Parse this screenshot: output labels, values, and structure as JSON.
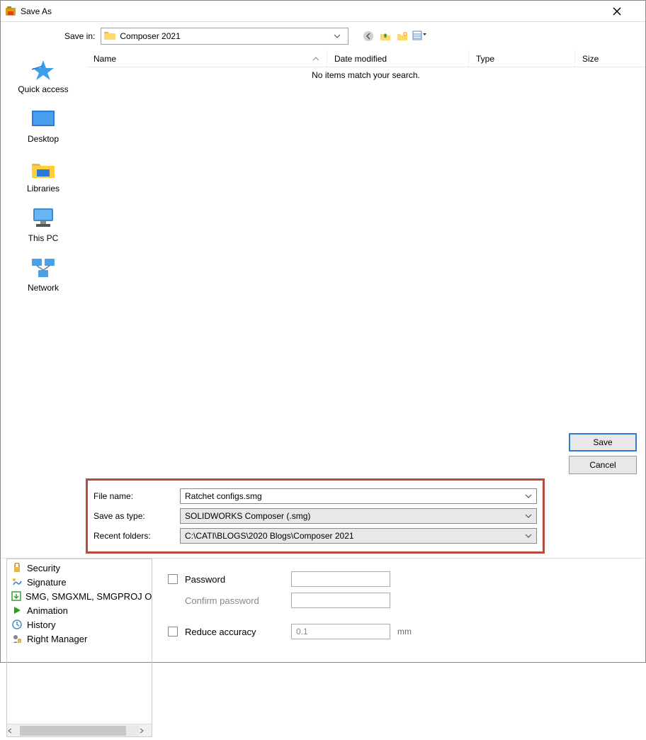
{
  "window": {
    "title": "Save As"
  },
  "savein": {
    "label": "Save in:",
    "folder": "Composer 2021"
  },
  "columns": {
    "name": "Name",
    "date": "Date modified",
    "type": "Type",
    "size": "Size"
  },
  "no_items_text": "No items match your search.",
  "places": {
    "quick": "Quick access",
    "desktop": "Desktop",
    "libraries": "Libraries",
    "thispc": "This PC",
    "network": "Network"
  },
  "fields": {
    "filename_label": "File name:",
    "filename_value": "Ratchet configs.smg",
    "type_label": "Save as type:",
    "type_value": "SOLIDWORKS Composer (.smg)",
    "recent_label": "Recent folders:",
    "recent_value": "C:\\CATI\\BLOGS\\2020 Blogs\\Composer 2021"
  },
  "buttons": {
    "save": "Save",
    "cancel": "Cancel"
  },
  "categories": {
    "security": "Security",
    "signature": "Signature",
    "smg": "SMG, SMGXML, SMGPROJ Output",
    "animation": "Animation",
    "history": "History",
    "rightmgr": "Right Manager"
  },
  "options": {
    "password_label": "Password",
    "confirm_label": "Confirm password",
    "reduce_label": "Reduce accuracy",
    "reduce_value": "0.1",
    "reduce_unit": "mm"
  }
}
